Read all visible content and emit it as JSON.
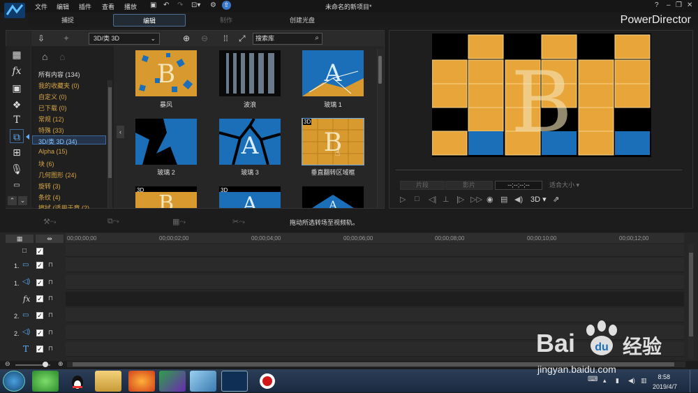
{
  "menu": [
    "文件",
    "编辑",
    "插件",
    "查看",
    "播放"
  ],
  "window_title": "未命名的新项目*",
  "tabs": [
    "捕捉",
    "编辑",
    "制作",
    "创建光盘"
  ],
  "brand": "PowerDirector",
  "library": {
    "category_dropdown": "3D/类 3D",
    "search_placeholder": "搜索库",
    "categories": [
      "所有内容 (134)",
      "我的收藏夹 (0)",
      "自定义 (0)",
      "已下载 (0)",
      "常规 (12)",
      "特殊 (33)",
      "3D/类 3D (34)",
      "Alpha (15)",
      "块 (6)",
      "几何图形 (24)",
      "旋转 (3)",
      "条纹 (4)",
      "擦拭 (适用于章 (2)"
    ],
    "transitions": [
      "暴风",
      "波浪",
      "玻璃 1",
      "玻璃 2",
      "玻璃 3",
      "垂直翻转区域框"
    ],
    "badge": "3D"
  },
  "preview": {
    "btn_clip": "片段",
    "btn_movie": "影片",
    "timecode": "--;--;--;--",
    "fit": "适合大小",
    "mode_3d": "3D"
  },
  "hint": "拖动所选转场至视频轨。",
  "ruler": [
    "00;00;00;00",
    "00;00;02;00",
    "00;00;04;00",
    "00;00;06;00",
    "00;00;08;00",
    "00;00;10;00",
    "00;00;12;00"
  ],
  "tracks": [
    "",
    "1.",
    "1.",
    "",
    "2.",
    "2.",
    ""
  ],
  "taskbar": {
    "time": "8:58",
    "date": "2019/4/7"
  },
  "watermark": {
    "brand": "Bai",
    "suffix": "经验",
    "url": "jingyan.baidu.com"
  }
}
